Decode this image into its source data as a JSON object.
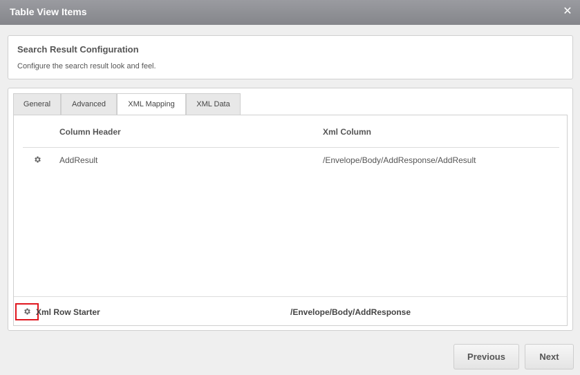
{
  "dialog": {
    "title": "Table View Items",
    "close_icon": "close-icon"
  },
  "config": {
    "title": "Search Result Configuration",
    "description": "Configure the search result look and feel."
  },
  "tabs": [
    {
      "label": "General",
      "active": false
    },
    {
      "label": "Advanced",
      "active": false
    },
    {
      "label": "XML Mapping",
      "active": true
    },
    {
      "label": "XML Data",
      "active": false
    }
  ],
  "mapping": {
    "headers": {
      "column_header": "Column Header",
      "xml_column": "Xml Column"
    },
    "rows": [
      {
        "icon": "gear-icon",
        "column_header": "AddResult",
        "xml_column": "/Envelope/Body/AddResponse/AddResult"
      }
    ],
    "row_starter": {
      "icon": "gear-icon",
      "label": "Xml Row Starter",
      "value": "/Envelope/Body/AddResponse"
    }
  },
  "footer": {
    "previous_label": "Previous",
    "next_label": "Next"
  },
  "colors": {
    "titlebar": "#8e8f94",
    "highlight": "#e0161e",
    "background": "#efefef"
  }
}
